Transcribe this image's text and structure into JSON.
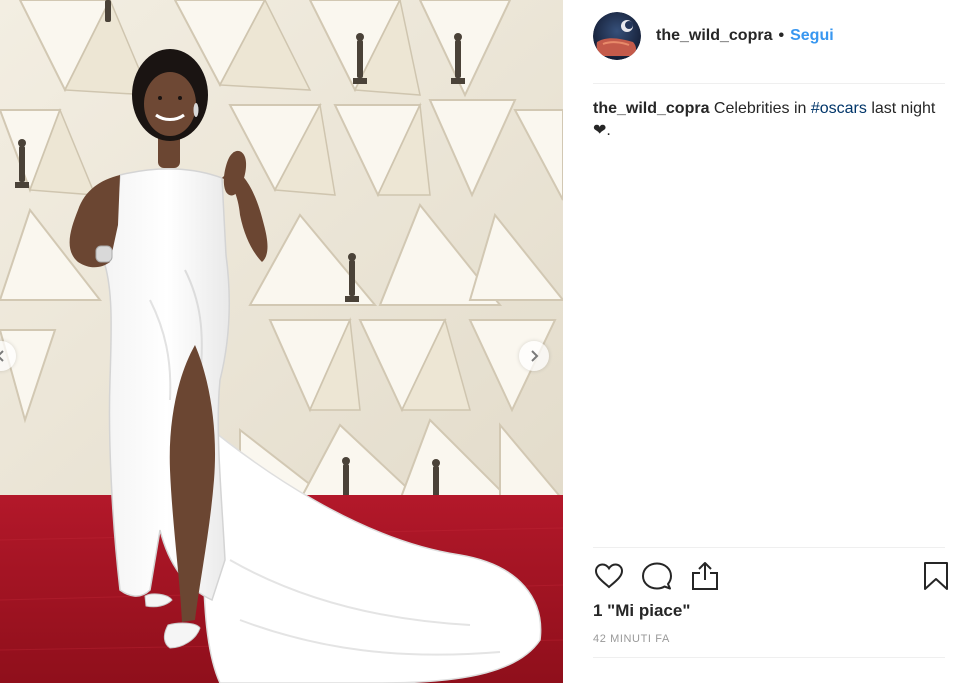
{
  "post": {
    "author": {
      "username": "the_wild_copra",
      "separator": "•",
      "follow_label": "Segui"
    },
    "caption": {
      "username": "the_wild_copra",
      "text_before": " Celebrities in ",
      "hashtag": "#oscars",
      "text_after": " last night ",
      "emoji": "❤",
      "end": "."
    },
    "likes_text": "1 \"Mi piace\"",
    "timestamp": "42 MINUTI FA",
    "icons": {
      "like": "heart-icon",
      "comment": "comment-bubble-icon",
      "share": "share-icon",
      "save": "bookmark-icon",
      "prev": "chevron-left-icon",
      "next": "chevron-right-icon"
    },
    "colors": {
      "link_blue": "#3897f0",
      "hashtag_navy": "#003569",
      "carpet_red": "#a5141f",
      "muted_gray": "#999999"
    }
  }
}
